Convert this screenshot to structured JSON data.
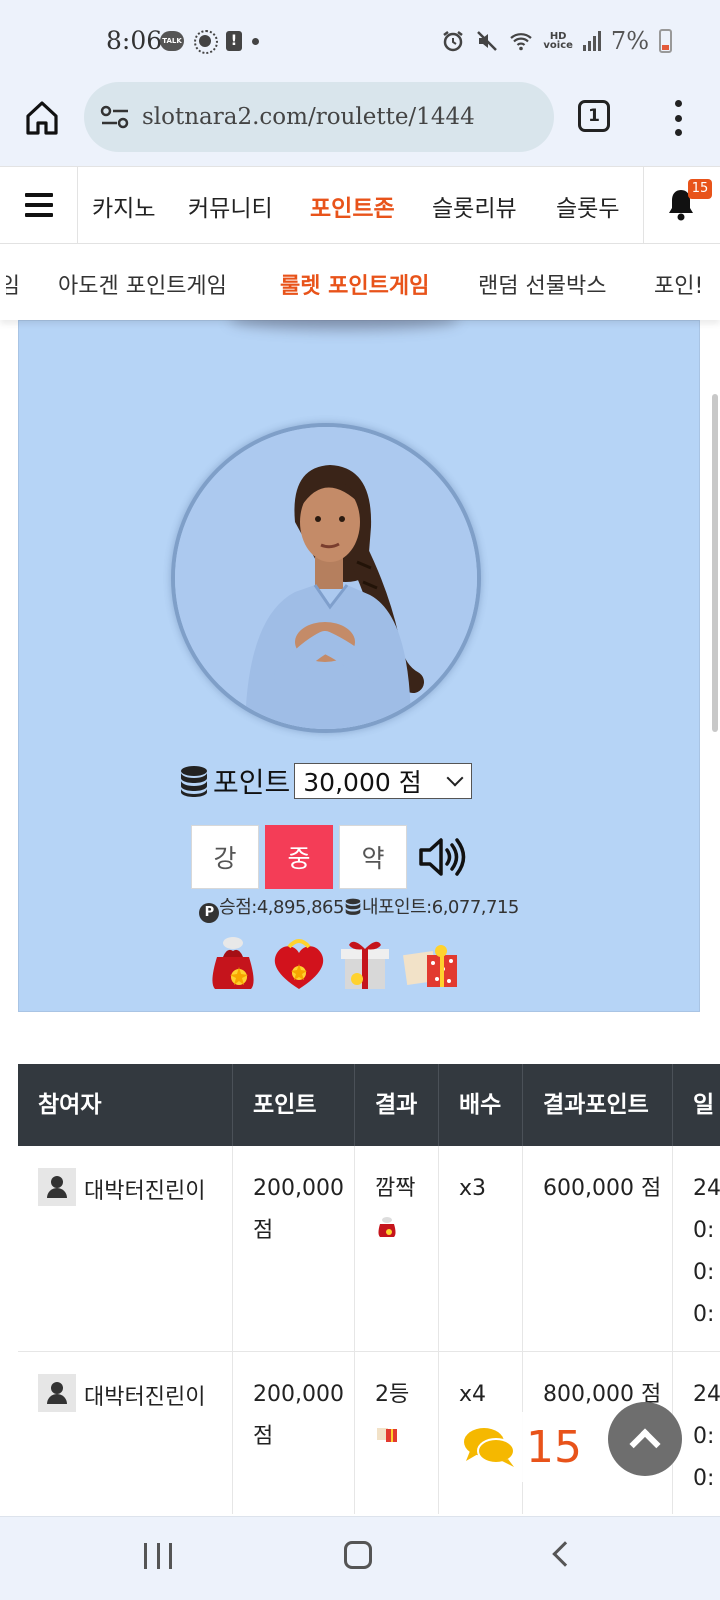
{
  "status_bar": {
    "time": "8:06",
    "talk_badge": "TALK",
    "alert_mark": "!",
    "hd_line1": "HD",
    "hd_line2": "voice",
    "battery": "7%"
  },
  "browser": {
    "url": "slotnara2.com/roulette/1444",
    "tab_count": "1"
  },
  "main_nav": {
    "items": [
      {
        "label": "카지노",
        "active": false
      },
      {
        "label": "커뮤니티",
        "active": false
      },
      {
        "label": "포인트존",
        "active": true
      },
      {
        "label": "슬롯리뷰",
        "active": false
      },
      {
        "label": "슬롯두",
        "active": false
      }
    ],
    "notification_count": "15"
  },
  "sub_nav": {
    "items": [
      {
        "label": "임",
        "active": false
      },
      {
        "label": "아도겐 포인트게임",
        "active": false
      },
      {
        "label": "룰렛 포인트게임",
        "active": true
      },
      {
        "label": "랜덤 선물박스",
        "active": false
      },
      {
        "label": "포인!",
        "active": false
      }
    ]
  },
  "game": {
    "points_label": "포인트",
    "bet_selected": "30,000 점",
    "strength_buttons": [
      "강",
      "중",
      "약"
    ],
    "strength_selected": "중",
    "win_label": "승점:",
    "win_points": "4,895,865",
    "my_points_label": "내포인트:",
    "my_points": "6,077,715",
    "p_badge": "P"
  },
  "table": {
    "headers": [
      "참여자",
      "포인트",
      "결과",
      "배수",
      "결과포인트",
      "일"
    ],
    "rows": [
      {
        "user": "대박터진린이",
        "points_line1": "200,000",
        "points_line2": "점",
        "result": "깜짝",
        "multiplier": "x3",
        "result_points": "600,000 점",
        "date": [
          "24",
          "0:",
          "0:",
          "0:"
        ]
      },
      {
        "user": "대박터진린이",
        "points_line1": "200,000",
        "points_line2": "점",
        "result": "2등",
        "multiplier": "x4",
        "result_points": "800,000 점",
        "date": [
          "24",
          "0:",
          "0:"
        ]
      }
    ]
  },
  "floating": {
    "chat_count": "15"
  },
  "colors": {
    "accent": "#e8531a",
    "game_bg": "#b6d4f6",
    "active_strength": "#f43d57",
    "table_header": "#33393f"
  }
}
